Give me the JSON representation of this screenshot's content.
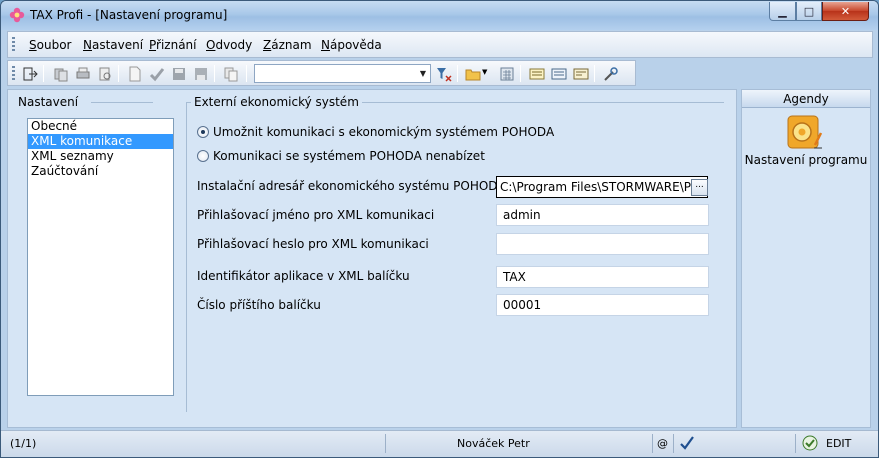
{
  "window": {
    "title": "TAX Profi - [Nastavení programu]",
    "min_glyph": "▁",
    "max_glyph": "□",
    "close_glyph": "✕"
  },
  "menu": {
    "items": [
      "Soubor",
      "Nastavení",
      "Přiznání",
      "Odvody",
      "Záznam",
      "Nápověda"
    ]
  },
  "toolbar": {
    "combo_value": "",
    "combo_arrow": "▼"
  },
  "nav": {
    "legend": "Nastavení",
    "items": [
      "Obecné",
      "XML komunikace",
      "XML seznamy",
      "Zaúčtování"
    ],
    "selected": "XML komunikace"
  },
  "group": {
    "legend": "Externí ekonomický systém",
    "radio_enable": "Umožnit komunikaci s ekonomickým systémem POHODA",
    "radio_offer": "Komunikaci se systémem POHODA nenabízet",
    "fields": {
      "install_dir": {
        "label": "Instalační adresář ekonomického systému POHODA",
        "value": "C:\\Program Files\\STORMWARE\\Pohoda"
      },
      "login": {
        "label": "Přihlašovací jméno pro XML komunikaci",
        "value": "admin"
      },
      "password": {
        "label": "Přihlašovací heslo pro XML komunikaci",
        "value": ""
      },
      "app_id": {
        "label": "Identifikátor aplikace v XML balíčku",
        "value": "TAX"
      },
      "next_packet": {
        "label": "Číslo příštího balíčku",
        "value": "00001"
      }
    },
    "browse_label": "..."
  },
  "agendy": {
    "header": "Agendy",
    "item_label": "Nastavení programu"
  },
  "status": {
    "record": "(1/1)",
    "user": "Nováček Petr",
    "at_glyph": "@",
    "mode": "EDIT"
  },
  "colors": {
    "selection": "#3399ff",
    "panel": "#d6e5f5",
    "window_frame": "#b9d1ea"
  }
}
